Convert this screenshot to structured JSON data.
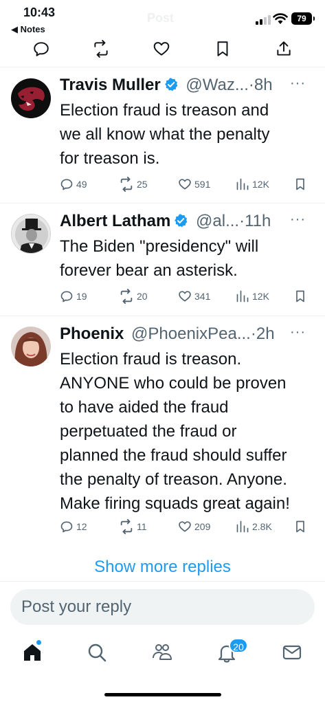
{
  "status_bar": {
    "time": "10:43",
    "back_app": "◀ Notes",
    "battery": "79",
    "ghost_title": "Post"
  },
  "top_actions": [
    "reply-icon",
    "repost-icon",
    "like-icon",
    "bookmark-icon",
    "share-icon"
  ],
  "tweets": [
    {
      "name": "Travis Muller",
      "verified": true,
      "handle": "@Waz...",
      "time": "8h",
      "lines": [
        "Election fraud is treason and",
        "we all know what the penalty",
        "for treason is."
      ],
      "replies": "49",
      "reposts": "25",
      "likes": "591",
      "views": "12K"
    },
    {
      "name": "Albert Latham",
      "verified": true,
      "handle": "@al...",
      "time": "11h",
      "lines": [
        "The Biden \"presidency\" will",
        "forever bear an asterisk."
      ],
      "replies": "19",
      "reposts": "20",
      "likes": "341",
      "views": "12K"
    },
    {
      "name": "Phoenix",
      "verified": false,
      "handle": "@PhoenixPea...",
      "time": "2h",
      "lines": [
        "Election fraud is treason.",
        "ANYONE who could be proven",
        "to have aided the fraud",
        "perpetuated the fraud or",
        "planned the fraud should suffer",
        "the penalty of treason. Anyone.",
        "Make firing squads great again!"
      ],
      "replies": "12",
      "reposts": "11",
      "likes": "209",
      "views": "2.8K"
    }
  ],
  "show_more": "Show more replies",
  "composer": {
    "placeholder": "Post your reply"
  },
  "nav": {
    "items": [
      "home-icon",
      "search-icon",
      "communities-icon",
      "notifications-icon",
      "messages-icon"
    ],
    "notification_count": "20"
  },
  "colors": {
    "accent": "#1d9bf0",
    "muted": "#536471",
    "text": "#0f1419"
  },
  "more_glyph": "···"
}
